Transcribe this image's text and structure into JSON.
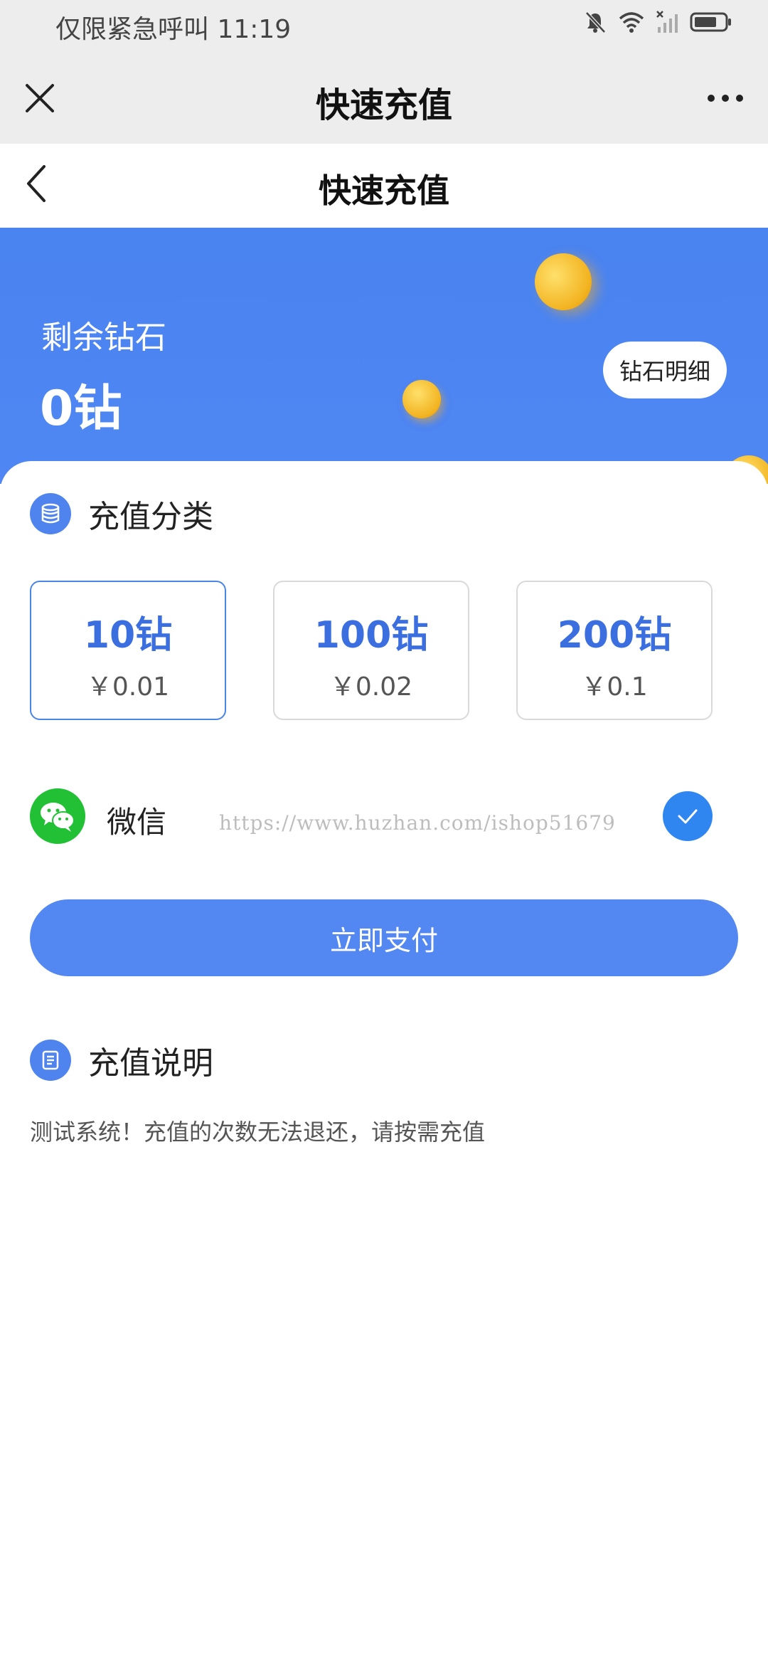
{
  "status_bar": {
    "text": "仅限紧急呼叫 11:19"
  },
  "top_bar": {
    "title": "快速充值"
  },
  "page_header": {
    "title": "快速充值"
  },
  "balance": {
    "label": "剩余钻石",
    "value": "0钻",
    "detail_button": "钻石明细"
  },
  "recharge_category": {
    "title": "充值分类",
    "options": [
      {
        "amount": "10钻",
        "price": "￥0.01",
        "selected": true
      },
      {
        "amount": "100钻",
        "price": "￥0.02",
        "selected": false
      },
      {
        "amount": "200钻",
        "price": "￥0.1",
        "selected": false
      }
    ]
  },
  "payment": {
    "method": "微信",
    "selected": true,
    "watermark": "https://www.huzhan.com/ishop51679"
  },
  "pay_button": "立即支付",
  "recharge_notes": {
    "title": "充值说明",
    "text": "测试系统！充值的次数无法退还，请按需充值"
  },
  "colors": {
    "primary": "#4f86f3",
    "accent_text": "#3b6fe0",
    "wechat_green": "#22c034",
    "check_blue": "#2f86f0"
  }
}
